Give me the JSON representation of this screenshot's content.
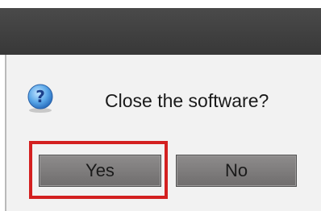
{
  "dialog": {
    "icon": "question-icon",
    "message": "Close the software?",
    "yes_label": "Yes",
    "no_label": "No"
  },
  "annotation": {
    "highlight_color": "#d32020",
    "highlights": "yes-button"
  }
}
